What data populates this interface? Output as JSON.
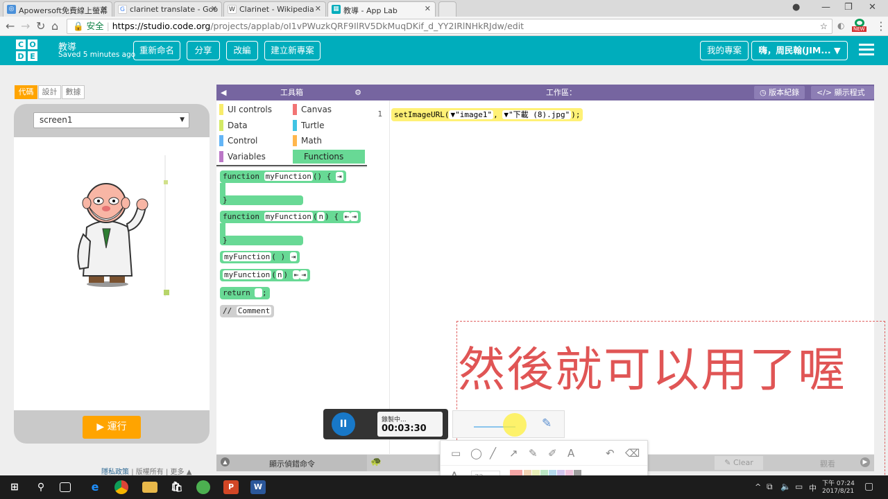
{
  "browser": {
    "tabs": [
      {
        "title": "Apowersoft免費線上螢幕",
        "icon": "apowersoft-icon",
        "color": "#4a90d9"
      },
      {
        "title": "clarinet translate - Goo",
        "icon": "google-icon",
        "color": "#4285f4"
      },
      {
        "title": "Clarinet - Wikipedia",
        "icon": "wikipedia-icon",
        "color": "#333333"
      },
      {
        "title": "教導 - App Lab",
        "icon": "applab-icon",
        "color": "#00adbc"
      }
    ],
    "address": {
      "secure_label": "安全",
      "url_host": "https://studio.code.org",
      "url_path": "/projects/applab/oI1vPWuzkQRF9IlRV5DkMuqDKif_d_YY2IRlNHkRJdw/edit"
    },
    "extension_badge": "NEW"
  },
  "header": {
    "logo_letters": [
      "C",
      "O",
      "D",
      "E"
    ],
    "project_name": "教導",
    "saved_status": "Saved 5 minutes ago",
    "rename_label": "重新命名",
    "share_label": "分享",
    "remix_label": "改編",
    "new_project_label": "建立新專案",
    "my_projects_label": "我的專案",
    "user_label": "嗨，周民翰(JIM..."
  },
  "app_panel": {
    "mode_tabs": [
      "代碼",
      "設計",
      "數據"
    ],
    "screen_select": "screen1",
    "run_label": "運行",
    "footer_links": [
      "隱私政策",
      "版權所有",
      "更多"
    ]
  },
  "toolbox": {
    "title": "工具箱",
    "categories": [
      {
        "label": "UI controls",
        "color": "#f8ec6b"
      },
      {
        "label": "Canvas",
        "color": "#f27474"
      },
      {
        "label": "Data",
        "color": "#d3e965"
      },
      {
        "label": "Turtle",
        "color": "#40c4e4"
      },
      {
        "label": "Control",
        "color": "#64b5f6"
      },
      {
        "label": "Math",
        "color": "#ffb74d"
      },
      {
        "label": "Variables",
        "color": "#bb77c7"
      },
      {
        "label": "Functions",
        "color": "#68d995"
      }
    ],
    "blocks": {
      "func_def_kw": "function",
      "func_name": "myFunction",
      "func_def_tail": "() {",
      "func_close": "}",
      "func_def_n_kw": "function",
      "func_def_n_name": "myFunction",
      "func_def_n_param": "n",
      "func_def_n_tail": ") {",
      "call_noargs": "myFunction",
      "call_noargs_tail": "( )",
      "call_arg_name": "myFunction",
      "call_arg_param": "n",
      "return_kw": "return",
      "return_tail": ";",
      "comment_prefix": "//",
      "comment_text": "Comment"
    }
  },
  "workspace": {
    "title": "工作區：",
    "version_label": "版本紀錄",
    "show_code_label": "顯示程式碼",
    "line_number": "1",
    "code_func": "setImageURL(",
    "code_arg1": "\"image1\"",
    "code_comma": ",",
    "code_arg2": "\"下載 (8).jpg\"",
    "code_end": ");"
  },
  "debug": {
    "show_commands_label": "顯示偵錯命令",
    "clear_label": "Clear",
    "watch_label": "觀看"
  },
  "recorder": {
    "status": "錄製中...",
    "time": "00:03:30",
    "font_size": "72",
    "palette": [
      "#f4a6a6",
      "#f2d3b3",
      "#f0e6b8",
      "#e9efb8",
      "#d2ecb8",
      "#bce7c5",
      "#b4e4de",
      "#b6dbee",
      "#bfd0f0",
      "#d2c6ef",
      "#e4c3ec",
      "#f0c2dc",
      "#f3c6c6",
      "#9e9e9e"
    ]
  },
  "overlay_text": "然後就可以用了喔",
  "taskbar": {
    "time": "下午 07:24",
    "date": "2017/8/21",
    "ime": "中"
  }
}
